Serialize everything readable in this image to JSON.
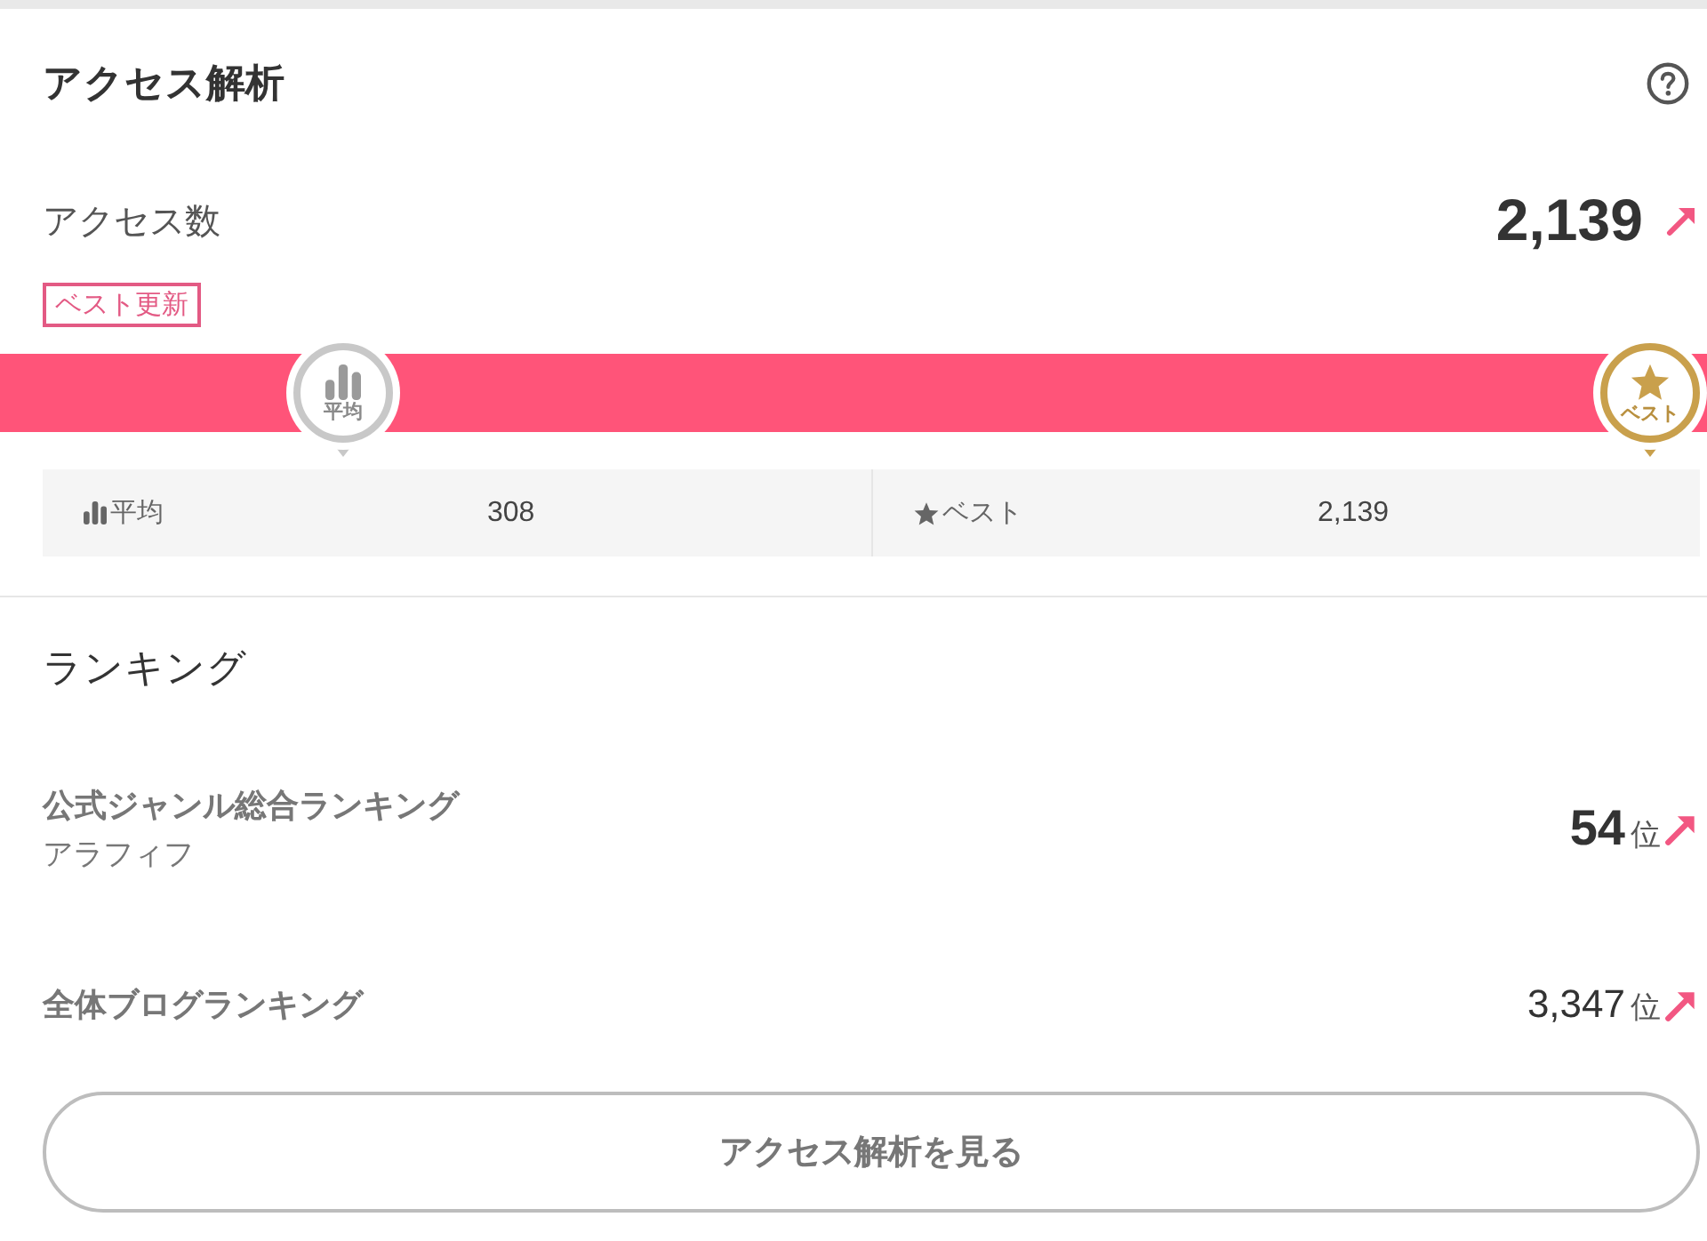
{
  "header": {
    "title": "アクセス解析"
  },
  "access": {
    "label": "アクセス数",
    "value": "2,139",
    "rising": true,
    "badge": "ベスト更新"
  },
  "meter": {
    "level": 1,
    "markers": [
      {
        "kind": "average",
        "label": "平均"
      },
      {
        "kind": "best",
        "label": "ベスト"
      }
    ]
  },
  "stats": [
    {
      "kind": "average",
      "label": "平均",
      "value": "308"
    },
    {
      "kind": "best",
      "label": "ベスト",
      "value": "2,139"
    }
  ],
  "ranking": {
    "title": "ランキング",
    "items": [
      {
        "kind": "genre",
        "name": "公式ジャンル総合ランキング",
        "genre": "アラフィフ",
        "rank": "54",
        "unit": "位",
        "rising": true
      },
      {
        "kind": "overall",
        "name": "全体ブログランキング",
        "rank": "3,347",
        "unit": "位",
        "rising": true
      }
    ]
  },
  "button": {
    "label": "アクセス解析を見る"
  }
}
